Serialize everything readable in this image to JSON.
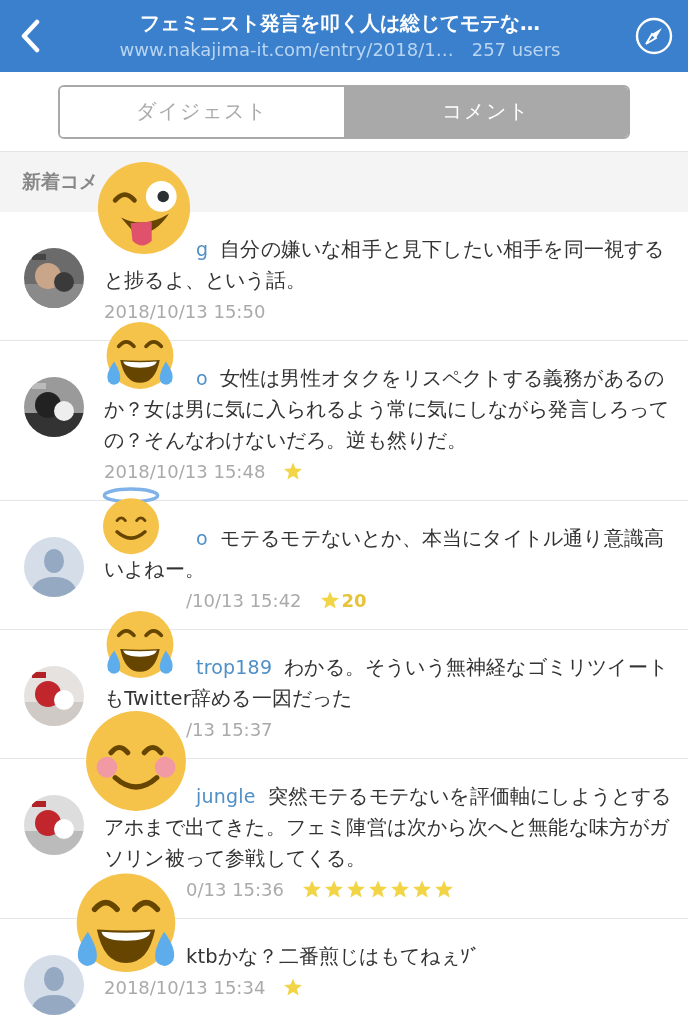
{
  "header": {
    "title": "フェミニスト発言を叩く人は総じてモテな…",
    "url": "www.nakajima-it.com/entry/2018/1…",
    "users": "257 users"
  },
  "tabs": [
    {
      "label": "ダイジェスト",
      "selected": false
    },
    {
      "label": "コメント",
      "selected": true
    }
  ],
  "section_title": "新着コメ",
  "comments": [
    {
      "user": "g",
      "text": "自分の嫌いな相手と見下したい相手を同一視すると捗るよ、という話。",
      "date": "2018/10/13 15:50",
      "date_covered": false,
      "starred": false,
      "sticker": {
        "kind": "wink"
      }
    },
    {
      "user": "o",
      "text": "女性は男性オタクをリスペクトする義務があるのか？女は男に気に入られるよう常に気にしながら発言しろっての？そんなわけないだろ。逆も然りだ。",
      "date": "2018/10/13 15:48",
      "date_covered": false,
      "starred": true,
      "sticker": {
        "kind": "joy"
      }
    },
    {
      "avatar": {
        "kind": "default"
      },
      "user": "o",
      "text": "モテるモテないとか、本当にタイトル通り意識高いよねー。",
      "date": "/10/13 15:42",
      "date_covered": true,
      "starred": true,
      "star_count": "20",
      "sticker": {
        "kind": "halo"
      }
    },
    {
      "user": "trop189",
      "text": "わかる。そういう無神経なゴミリツイートもTwitter辞める一因だった",
      "date": "/13 15:37",
      "date_covered": true,
      "starred": false,
      "sticker": {
        "kind": "joy"
      }
    },
    {
      "user": "jungle",
      "text": "突然モテるモテないを評価軸にしようとするアホまで出てきた。フェミ陣営は次から次へと無能な味方がガソリン被って参戦してくる。",
      "date": "0/13 15:36",
      "date_covered": true,
      "stars": 7,
      "sticker": {
        "kind": "blush"
      }
    },
    {
      "avatar": {
        "kind": "default"
      },
      "text": "ktbかな？二番煎じはもてねぇｿﾞ",
      "date": "2018/10/13 15:34",
      "date_covered": false,
      "starred": true,
      "sticker": {
        "kind": "joy"
      }
    }
  ]
}
